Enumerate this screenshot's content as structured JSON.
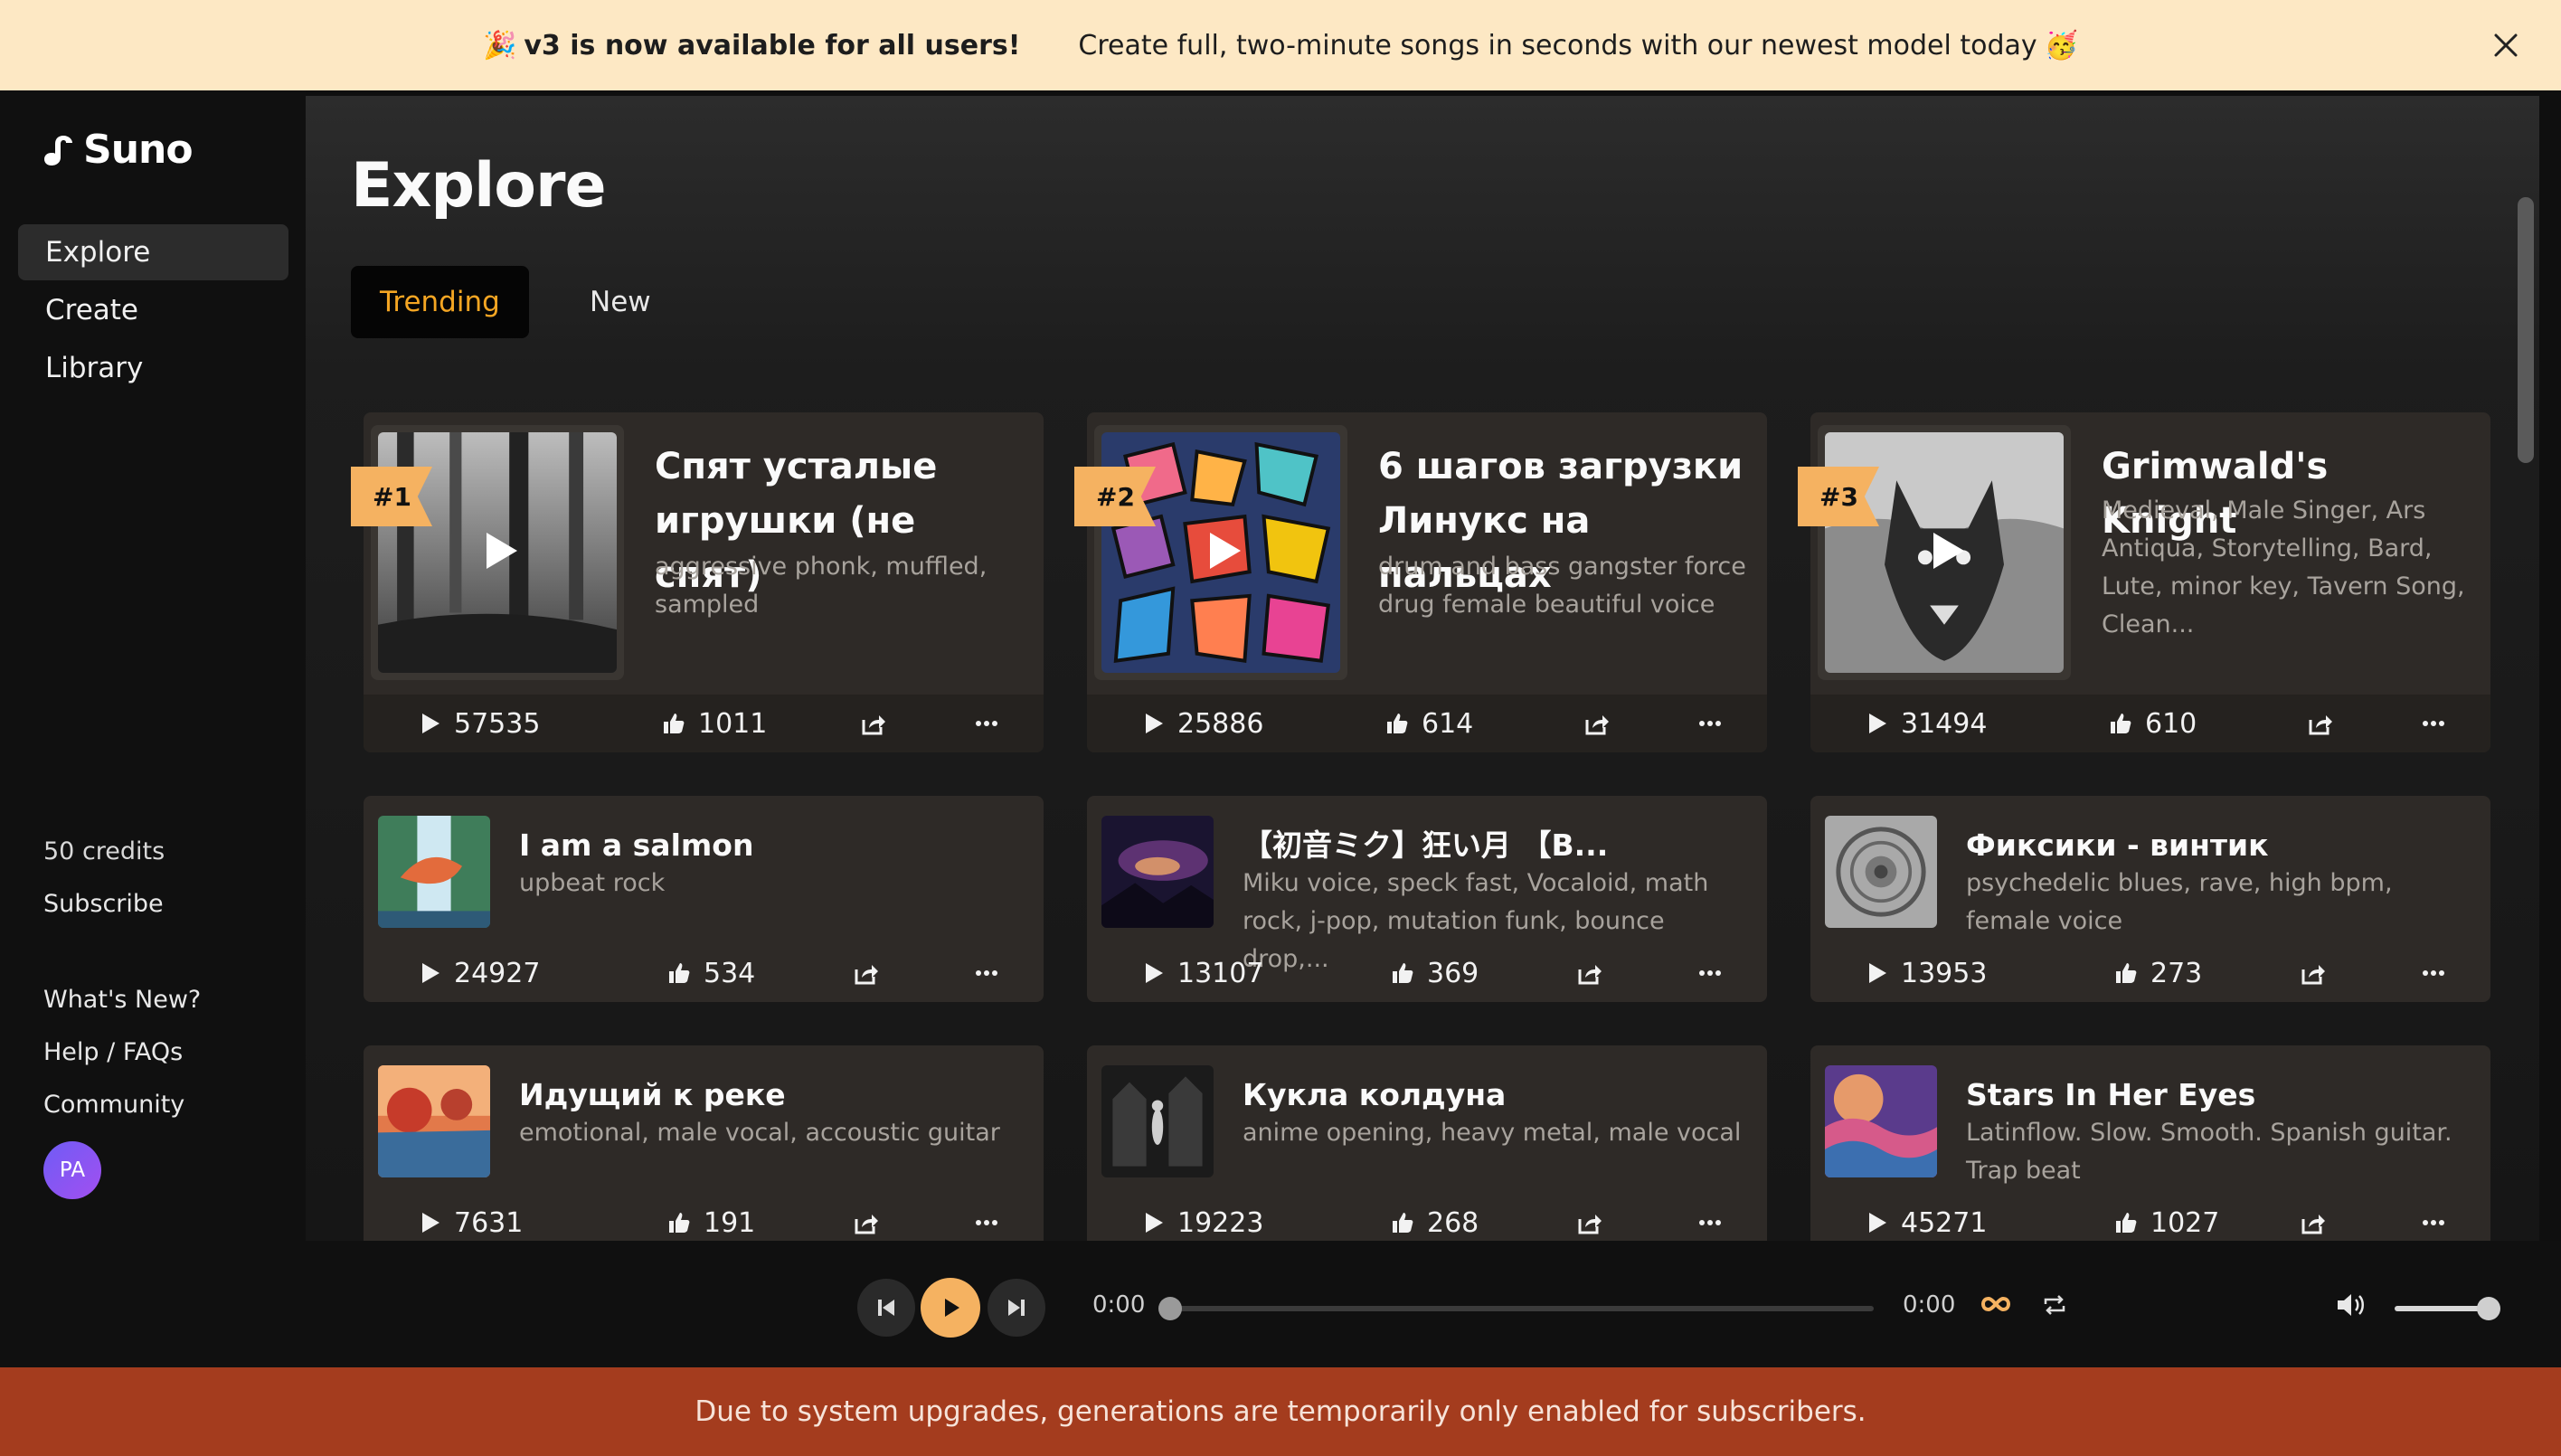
{
  "announcement": {
    "emoji_left": "🎉",
    "bold": "v3 is now available for all users!",
    "text": "Create full, two-minute songs in seconds with our newest model today",
    "emoji_right": "🥳"
  },
  "sidebar": {
    "logo": "Suno",
    "nav": [
      {
        "label": "Explore"
      },
      {
        "label": "Create"
      },
      {
        "label": "Library"
      }
    ],
    "credits": "50 credits",
    "subscribe": "Subscribe",
    "links": [
      {
        "label": "What's New?"
      },
      {
        "label": "Help / FAQs"
      },
      {
        "label": "Community"
      }
    ],
    "avatar": "PA"
  },
  "main": {
    "title": "Explore",
    "tabs": [
      {
        "label": "Trending",
        "active": true
      },
      {
        "label": "New",
        "active": false
      }
    ]
  },
  "featured": [
    {
      "rank": "#1",
      "title": "Спят усталые игрушки (не спят)",
      "tags": "aggressive phonk, muffled, sampled",
      "plays": "57535",
      "likes": "1011",
      "art": "forest-art"
    },
    {
      "rank": "#2",
      "title": "6 шагов загрузки Линукс на пальцах",
      "tags": "drum and bass gangster force drug female beautiful voice",
      "plays": "25886",
      "likes": "614",
      "art": "mosaic-art"
    },
    {
      "rank": "#3",
      "title": "Grimwald's Knight",
      "tags": "Medieval, Male Singer, Ars Antiqua, Storytelling, Bard, Lute, minor key, Tavern Song, Clean...",
      "plays": "31494",
      "likes": "610",
      "art": "wolf-art"
    }
  ],
  "songs": [
    {
      "title": "I am a salmon",
      "tags": "upbeat rock",
      "plays": "24927",
      "likes": "534",
      "art": "salmon-art"
    },
    {
      "title": "【初音ミク】狂い月 【B...",
      "tags": "Miku voice, speck fast, Vocaloid, math rock, j-pop, mutation funk, bounce drop,...",
      "plays": "13107",
      "likes": "369",
      "art": "galaxy-art"
    },
    {
      "title": "Фиксики - винтик",
      "tags": "psychedelic blues, rave, high bpm, female voice",
      "plays": "13953",
      "likes": "273",
      "art": "mandala-art"
    },
    {
      "title": "Идущий к реке",
      "tags": "emotional, male vocal, accoustic guitar",
      "plays": "7631",
      "likes": "191",
      "art": "river-art"
    },
    {
      "title": "Кукла колдуна",
      "tags": "anime opening, heavy metal, male vocal",
      "plays": "19223",
      "likes": "268",
      "art": "dark-art"
    },
    {
      "title": "Stars In Her Eyes",
      "tags": "Latinflow. Slow. Smooth. Spanish guitar. Trap beat",
      "plays": "45271",
      "likes": "1027",
      "art": "sky-art"
    }
  ],
  "player": {
    "time_current": "0:00",
    "time_total": "0:00",
    "progress": 0,
    "volume": 1.0
  },
  "notice": "Due to system upgrades, generations are temporarily only enabled for subscribers.",
  "colors": {
    "accent": "#f5b261",
    "active_tab_text": "#f5a623",
    "announcement_bg": "#fde8c4",
    "notice_bg": "#a43c1e"
  }
}
